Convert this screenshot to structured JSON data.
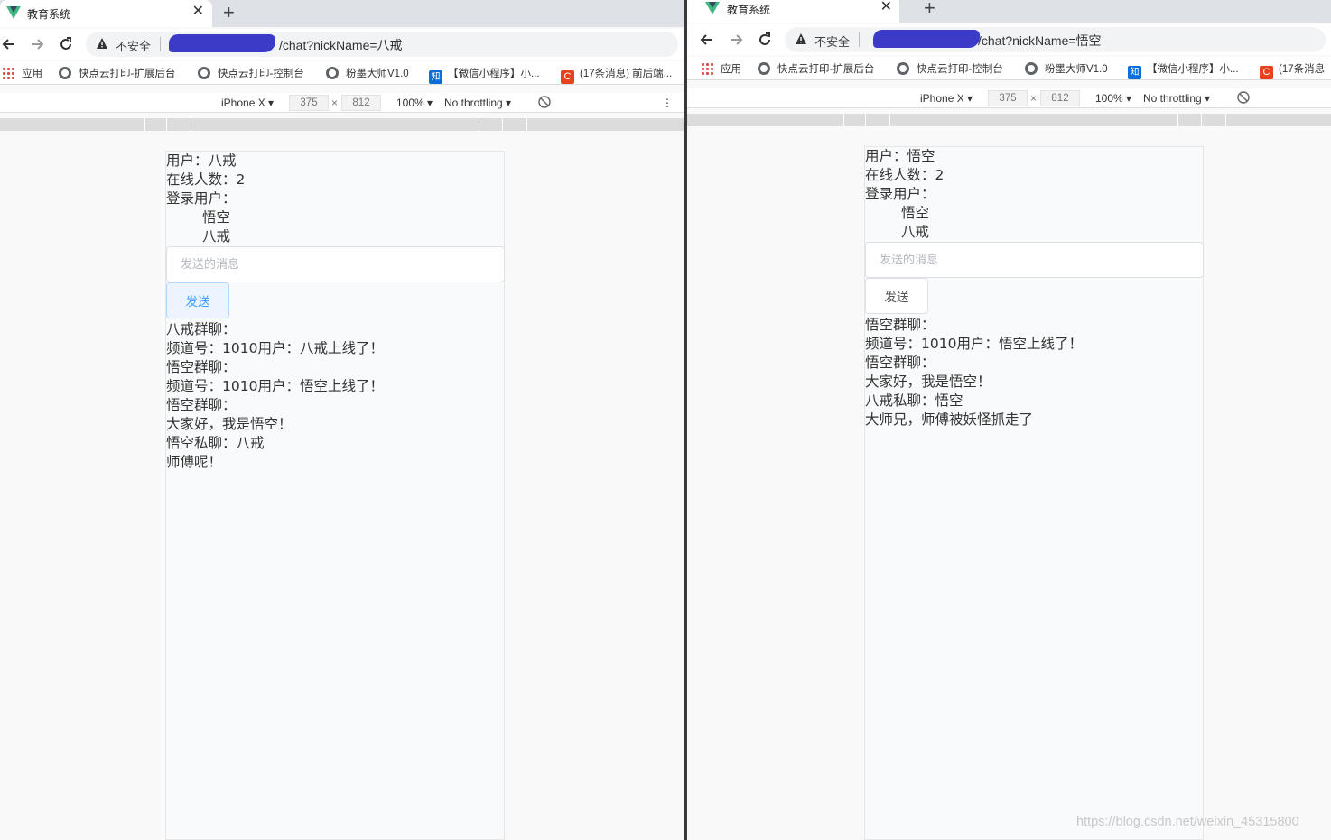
{
  "colors": {
    "vue_green": "#41b883",
    "vue_dark": "#35495e",
    "redaction": "#3b3bc8",
    "element_primary": "#409eff"
  },
  "left": {
    "tab_title": "教育系统",
    "insecure_label": "不安全",
    "url_tail": "/chat?nickName=八戒",
    "bookmarks": [
      "应用",
      "快点云打印-扩展后台",
      "快点云打印-控制台",
      "粉墨大师V1.0",
      "【微信小程序】小...",
      "(17条消息) 前后端..."
    ],
    "device": {
      "name": "iPhone X",
      "width": "375",
      "height": "812",
      "zoom": "100%",
      "throttle": "No throttling"
    },
    "user_line": "用户：八戒",
    "online_line": "在线人数：2",
    "login_label": "登录用户：",
    "users": [
      "悟空",
      "八戒"
    ],
    "input_placeholder": "发送的消息",
    "send_label": "发送",
    "messages": [
      "八戒群聊：",
      "频道号：1010用户：八戒上线了！",
      "悟空群聊：",
      "频道号：1010用户：悟空上线了！",
      "悟空群聊：",
      "大家好，我是悟空！",
      "悟空私聊：八戒",
      "师傅呢！"
    ]
  },
  "right": {
    "tab_title": "教育系统",
    "insecure_label": "不安全",
    "url_tail": "/chat?nickName=悟空",
    "bookmarks": [
      "应用",
      "快点云打印-扩展后台",
      "快点云打印-控制台",
      "粉墨大师V1.0",
      "【微信小程序】小...",
      "(17条消息"
    ],
    "device": {
      "name": "iPhone X",
      "width": "375",
      "height": "812",
      "zoom": "100%",
      "throttle": "No throttling"
    },
    "user_line": "用户：悟空",
    "online_line": "在线人数：2",
    "login_label": "登录用户：",
    "users": [
      "悟空",
      "八戒"
    ],
    "input_placeholder": "发送的消息",
    "send_label": "发送",
    "messages": [
      "悟空群聊：",
      "频道号：1010用户：悟空上线了！",
      "悟空群聊：",
      "大家好，我是悟空！",
      "八戒私聊：悟空",
      "大师兄，师傅被妖怪抓走了"
    ]
  },
  "watermark": "https://blog.csdn.net/weixin_45315800"
}
